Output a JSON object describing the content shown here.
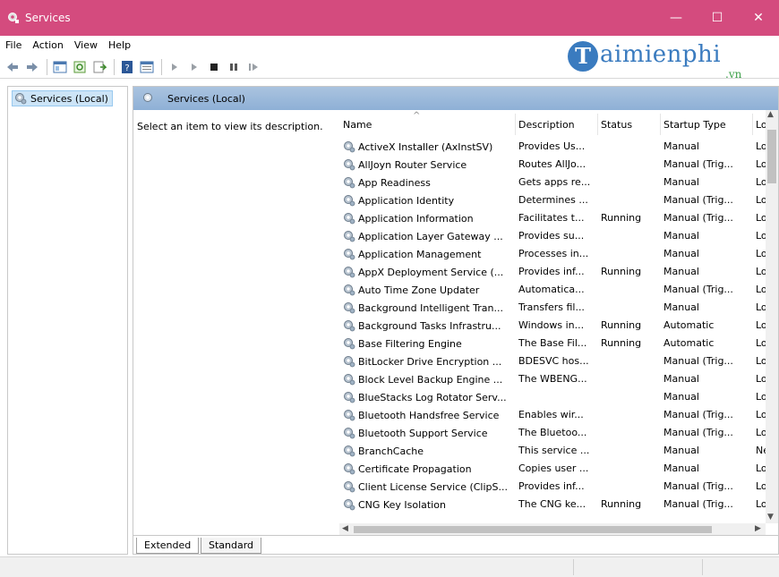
{
  "window": {
    "title": "Services",
    "minimize_glyph": "—",
    "maximize_glyph": "☐",
    "close_glyph": "✕"
  },
  "menu": [
    "File",
    "Action",
    "View",
    "Help"
  ],
  "watermark": {
    "initial": "T",
    "name": "aimienphi",
    "suffix": ".vn"
  },
  "tree": {
    "root_label": "Services (Local)"
  },
  "pane": {
    "header_title": "Services (Local)",
    "description_hint": "Select an item to view its description."
  },
  "table": {
    "columns": [
      "Name",
      "Description",
      "Status",
      "Startup Type",
      "Log"
    ],
    "rows": [
      [
        "ActiveX Installer (AxInstSV)",
        "Provides Us...",
        "",
        "Manual",
        "Loc"
      ],
      [
        "AllJoyn Router Service",
        "Routes AllJo...",
        "",
        "Manual (Trig...",
        "Loc"
      ],
      [
        "App Readiness",
        "Gets apps re...",
        "",
        "Manual",
        "Loc"
      ],
      [
        "Application Identity",
        "Determines ...",
        "",
        "Manual (Trig...",
        "Loc"
      ],
      [
        "Application Information",
        "Facilitates t...",
        "Running",
        "Manual (Trig...",
        "Loc"
      ],
      [
        "Application Layer Gateway ...",
        "Provides su...",
        "",
        "Manual",
        "Loc"
      ],
      [
        "Application Management",
        "Processes in...",
        "",
        "Manual",
        "Loc"
      ],
      [
        "AppX Deployment Service (...",
        "Provides inf...",
        "Running",
        "Manual",
        "Loc"
      ],
      [
        "Auto Time Zone Updater",
        "Automatica...",
        "",
        "Manual (Trig...",
        "Loc"
      ],
      [
        "Background Intelligent Tran...",
        "Transfers fil...",
        "",
        "Manual",
        "Loc"
      ],
      [
        "Background Tasks Infrastru...",
        "Windows in...",
        "Running",
        "Automatic",
        "Loc"
      ],
      [
        "Base Filtering Engine",
        "The Base Fil...",
        "Running",
        "Automatic",
        "Loc"
      ],
      [
        "BitLocker Drive Encryption ...",
        "BDESVC hos...",
        "",
        "Manual (Trig...",
        "Loc"
      ],
      [
        "Block Level Backup Engine ...",
        "The WBENG...",
        "",
        "Manual",
        "Loc"
      ],
      [
        "BlueStacks Log Rotator Serv...",
        "",
        "",
        "Manual",
        "Loc"
      ],
      [
        "Bluetooth Handsfree Service",
        "Enables wir...",
        "",
        "Manual (Trig...",
        "Loc"
      ],
      [
        "Bluetooth Support Service",
        "The Bluetoo...",
        "",
        "Manual (Trig...",
        "Loc"
      ],
      [
        "BranchCache",
        "This service ...",
        "",
        "Manual",
        "Net"
      ],
      [
        "Certificate Propagation",
        "Copies user ...",
        "",
        "Manual",
        "Loc"
      ],
      [
        "Client License Service (ClipS...",
        "Provides inf...",
        "",
        "Manual (Trig...",
        "Loc"
      ],
      [
        "CNG Key Isolation",
        "The CNG ke...",
        "Running",
        "Manual (Trig...",
        "Loc"
      ]
    ]
  },
  "tabs": [
    "Extended",
    "Standard"
  ],
  "colors": {
    "titlebar": "#d44b7e",
    "pane_header": "#9dbbdc",
    "selection": "#cce4f7",
    "logo_blue": "#3a7bbf",
    "logo_green": "#3ea04a"
  },
  "icons": {
    "app": "services-gear-icon",
    "row": "service-gear-icon",
    "toolbar": [
      "back-icon",
      "forward-icon",
      "up-icon",
      "show-hide-tree-icon",
      "refresh-icon",
      "export-list-icon",
      "help-icon",
      "properties-icon",
      "start-icon",
      "start-alt-icon",
      "stop-icon",
      "pause-icon",
      "restart-icon"
    ]
  }
}
